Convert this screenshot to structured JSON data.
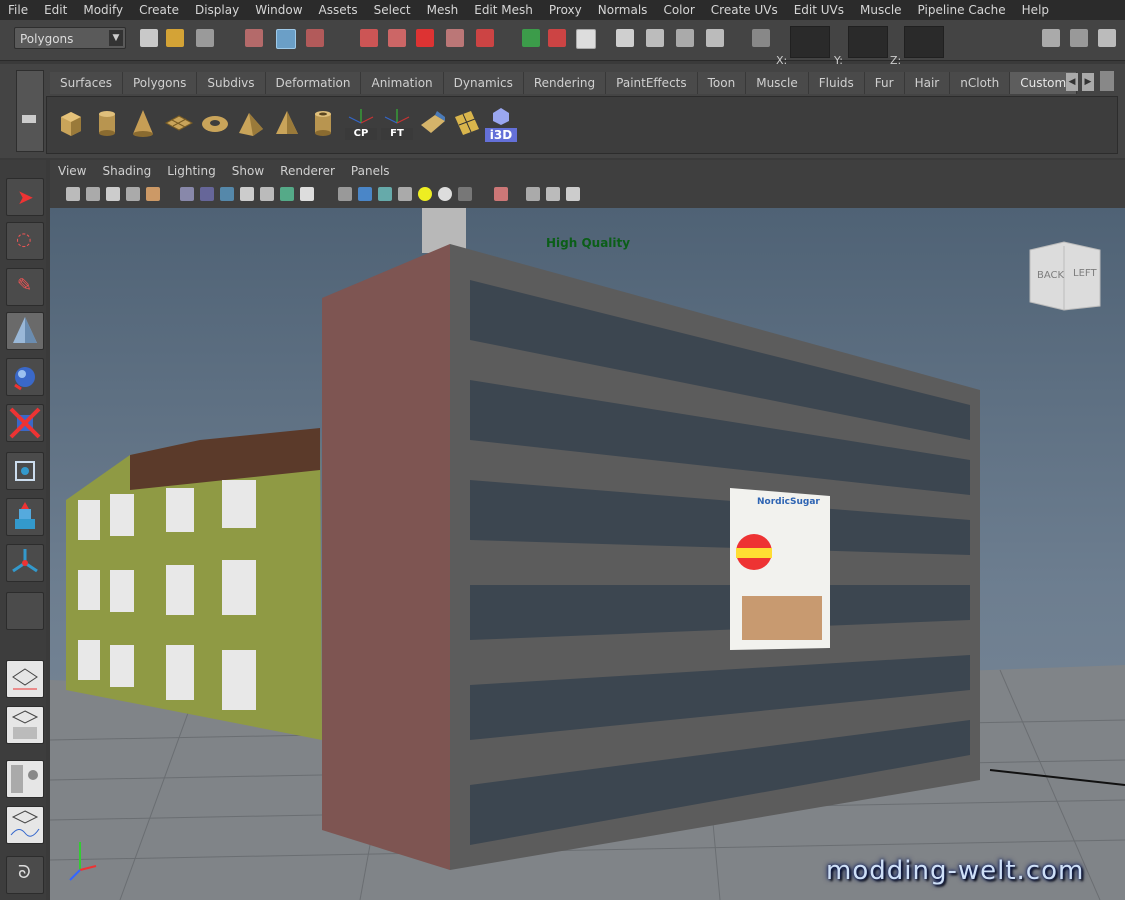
{
  "menubar": {
    "items": [
      "File",
      "Edit",
      "Modify",
      "Create",
      "Display",
      "Window",
      "Assets",
      "Select",
      "Mesh",
      "Edit Mesh",
      "Proxy",
      "Normals",
      "Color",
      "Create UVs",
      "Edit UVs",
      "Muscle",
      "Pipeline Cache",
      "Help"
    ]
  },
  "status_line": {
    "mode_value": "Polygons",
    "x_label": "X:",
    "y_label": "Y:",
    "z_label": "Z:"
  },
  "shelf": {
    "tabs": [
      "Surfaces",
      "Polygons",
      "Subdivs",
      "Deformation",
      "Animation",
      "Dynamics",
      "Rendering",
      "PaintEffects",
      "Toon",
      "Muscle",
      "Fluids",
      "Fur",
      "Hair",
      "nCloth",
      "Custom"
    ],
    "active_tab": "Custom",
    "icons": [
      "cube-icon",
      "cylinder-icon",
      "cone-icon",
      "plane-icon",
      "torus-icon",
      "prism-icon",
      "pyramid-icon",
      "pipe-icon",
      "cp-icon",
      "ft-icon",
      "uv-map-icon",
      "checker-icon",
      "i3d-icon"
    ],
    "icon_labels": {
      "cp": "CP",
      "ft": "FT",
      "i3d": "i3D"
    }
  },
  "panel": {
    "menu": [
      "View",
      "Shading",
      "Lighting",
      "Show",
      "Renderer",
      "Panels"
    ]
  },
  "viewport": {
    "hud_text": "High Quality",
    "viewcube_back": "BACK",
    "viewcube_left": "LEFT",
    "billboard_brand": "NordicSugar",
    "watermark": "modding-welt.com"
  },
  "colors": {
    "hud_text": "#0b5e18",
    "watermark": "#cfe0f7",
    "active_tab": "#5d5d5d"
  }
}
